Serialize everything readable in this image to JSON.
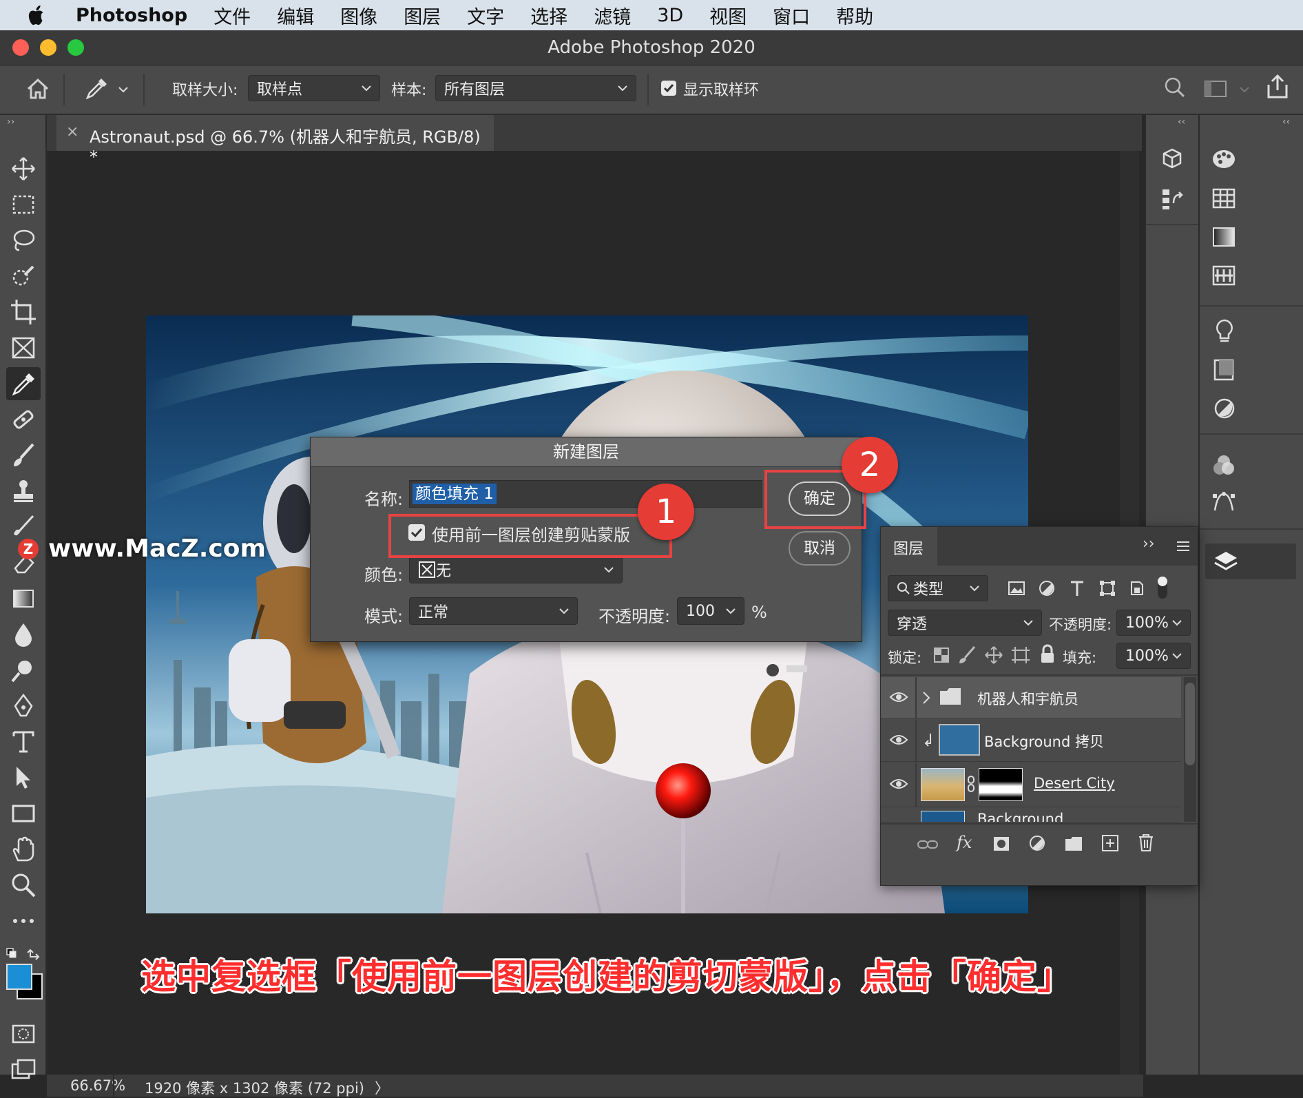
{
  "menubar": {
    "app_name": "Photoshop",
    "items": [
      "文件",
      "编辑",
      "图像",
      "图层",
      "文字",
      "选择",
      "滤镜",
      "3D",
      "视图",
      "窗口",
      "帮助"
    ]
  },
  "window": {
    "title": "Adobe Photoshop 2020"
  },
  "options_bar": {
    "sample_size_label": "取样大小:",
    "sample_size_value": "取样点",
    "sample_label": "样本:",
    "sample_value": "所有图层",
    "show_ring_label": "显示取样环",
    "show_ring_checked": true
  },
  "document": {
    "tab_title": "Astronaut.psd @ 66.7% (机器人和宇航员, RGB/8) *",
    "close": "×"
  },
  "dialog": {
    "title": "新建图层",
    "name_label": "名称:",
    "name_value": "颜色填充 1",
    "clip_checkbox_label": "使用前一图层创建剪贴蒙版",
    "clip_checked": true,
    "color_label": "颜色:",
    "color_value": "无",
    "mode_label": "模式:",
    "mode_value": "正常",
    "opacity_label": "不透明度:",
    "opacity_value": "100",
    "opacity_unit": "%",
    "ok_label": "确定",
    "cancel_label": "取消"
  },
  "annotations": {
    "badge1": "1",
    "badge2": "2"
  },
  "layers_panel": {
    "tab_label": "图层",
    "filter_label": "类型",
    "blend_mode": "穿透",
    "opacity_label": "不透明度:",
    "opacity_value": "100%",
    "lock_label": "锁定:",
    "fill_label": "填充:",
    "fill_value": "100%",
    "layers": [
      {
        "name": "机器人和宇航员",
        "type": "group"
      },
      {
        "name": "Background 拷贝",
        "type": "fill"
      },
      {
        "name": "Desert City",
        "type": "image-mask"
      },
      {
        "name": "Background",
        "type": "image"
      }
    ]
  },
  "status_bar": {
    "zoom": "66.67%",
    "doc_info": "1920 像素 x 1302 像素 (72 ppi)",
    "arrow": "〉"
  },
  "watermark": "www.MacZ.com",
  "caption": "选中复选框「使用前一图层创建的剪切蒙版」，点击「确定」",
  "colors": {
    "foreground": "#1a8fd6",
    "background": "#000000",
    "accent_red": "#e53c35"
  }
}
